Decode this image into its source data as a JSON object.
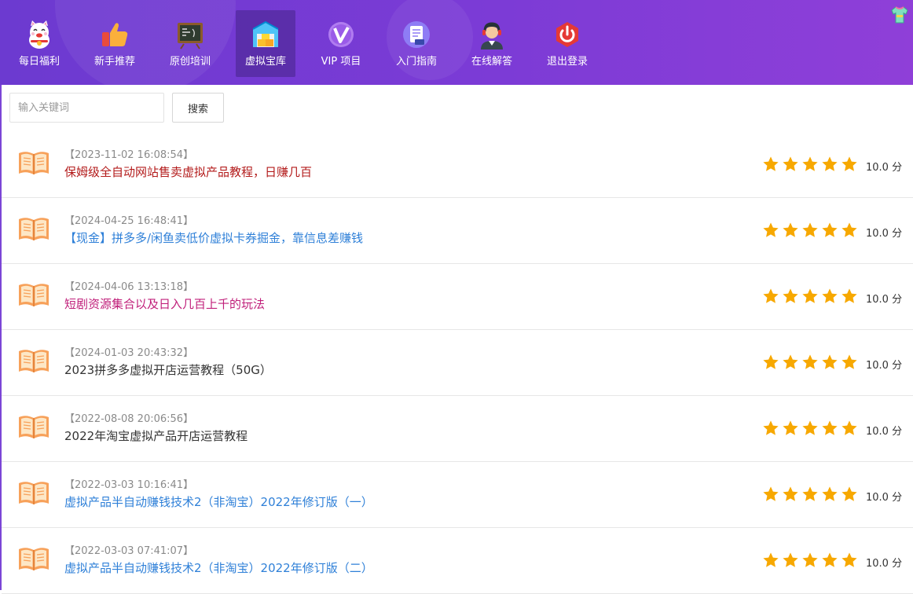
{
  "colors": {
    "header_start": "#6c3ad0",
    "header_end": "#8f3fd8",
    "star": "#f7a800",
    "title_dark_red": "#b31b1b",
    "title_blue": "#2f80d8",
    "title_magenta": "#c01f7a",
    "title_dark": "#333333"
  },
  "nav": {
    "items": [
      {
        "label": "每日福利",
        "icon": "lucky-cat-icon"
      },
      {
        "label": "新手推荐",
        "icon": "thumbs-up-icon"
      },
      {
        "label": "原创培训",
        "icon": "blackboard-icon"
      },
      {
        "label": "虚拟宝库",
        "icon": "warehouse-icon",
        "active": true
      },
      {
        "label": "VIP 项目",
        "icon": "vip-icon"
      },
      {
        "label": "入门指南",
        "icon": "guide-doc-icon"
      },
      {
        "label": "在线解答",
        "icon": "support-agent-icon"
      },
      {
        "label": "退出登录",
        "icon": "power-icon"
      }
    ],
    "corner_icon": "tshirt-icon"
  },
  "search": {
    "placeholder": "输入关键词",
    "value": "",
    "button_label": "搜索"
  },
  "list": {
    "items": [
      {
        "date": "【2023-11-02 16:08:54】",
        "title": "保姆级全自动网站售卖虚拟产品教程，日赚几百",
        "title_color": "#b31b1b",
        "rating": 5,
        "score": "10.0 分"
      },
      {
        "date": "【2024-04-25 16:48:41】",
        "title": "【现金】拼多多/闲鱼卖低价虚拟卡券掘金，靠信息差赚钱",
        "title_color": "#2f80d8",
        "rating": 5,
        "score": "10.0 分"
      },
      {
        "date": "【2024-04-06 13:13:18】",
        "title": "短剧资源集合以及日入几百上千的玩法",
        "title_color": "#c01f7a",
        "rating": 5,
        "score": "10.0 分"
      },
      {
        "date": "【2024-01-03 20:43:32】",
        "title": "2023拼多多虚拟开店运营教程（50G）",
        "title_color": "#333333",
        "rating": 5,
        "score": "10.0 分"
      },
      {
        "date": "【2022-08-08 20:06:56】",
        "title": "2022年淘宝虚拟产品开店运营教程",
        "title_color": "#333333",
        "rating": 5,
        "score": "10.0 分"
      },
      {
        "date": "【2022-03-03 10:16:41】",
        "title": "虚拟产品半自动赚钱技术2（非淘宝）2022年修订版（一）",
        "title_color": "#2f80d8",
        "rating": 5,
        "score": "10.0 分"
      },
      {
        "date": "【2022-03-03 07:41:07】",
        "title": "虚拟产品半自动赚钱技术2（非淘宝）2022年修订版（二）",
        "title_color": "#2f80d8",
        "rating": 5,
        "score": "10.0 分"
      }
    ]
  }
}
